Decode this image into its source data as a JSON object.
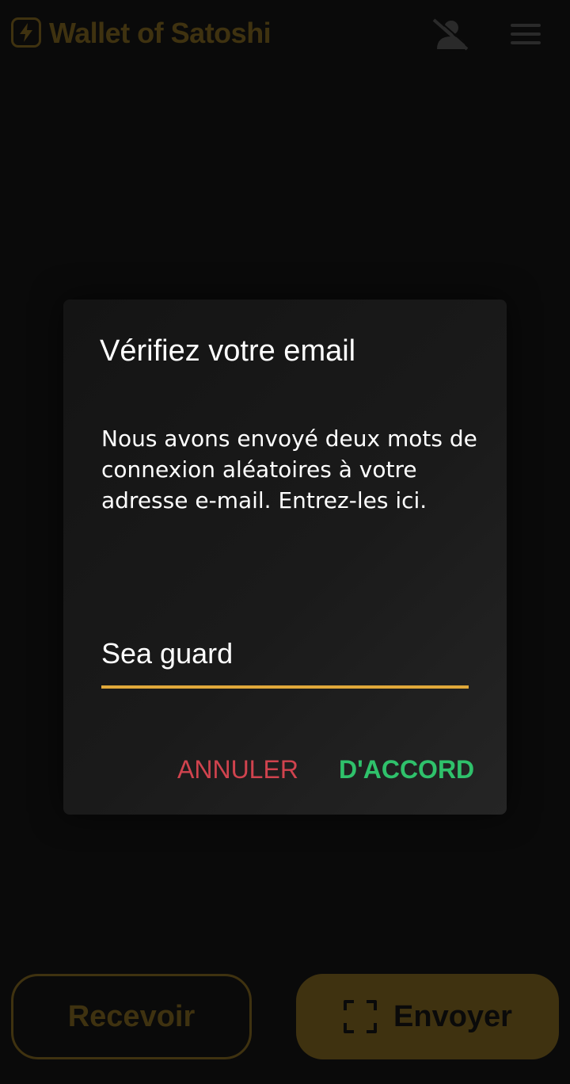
{
  "header": {
    "app_title": "Wallet of Satoshi",
    "logo_icon": "lightning-bolt-icon",
    "profile_icon": "user-off-icon",
    "menu_icon": "hamburger-menu-icon",
    "dim_color": "#3f3210"
  },
  "dialog": {
    "title": "Vérifiez votre email",
    "body": "Nous avons envoyé deux mots de connexion aléatoires à votre adresse e-mail. Entrez-les ici.",
    "input_value": "Sea guard",
    "cancel_label": "ANNULER",
    "ok_label": "D'ACCORD",
    "accent_color": "#e0a83a",
    "cancel_color": "#d0434e",
    "ok_color": "#2fc16b"
  },
  "footer": {
    "receive_label": "Recevoir",
    "send_label": "Envoyer",
    "send_icon": "scan-icon"
  }
}
